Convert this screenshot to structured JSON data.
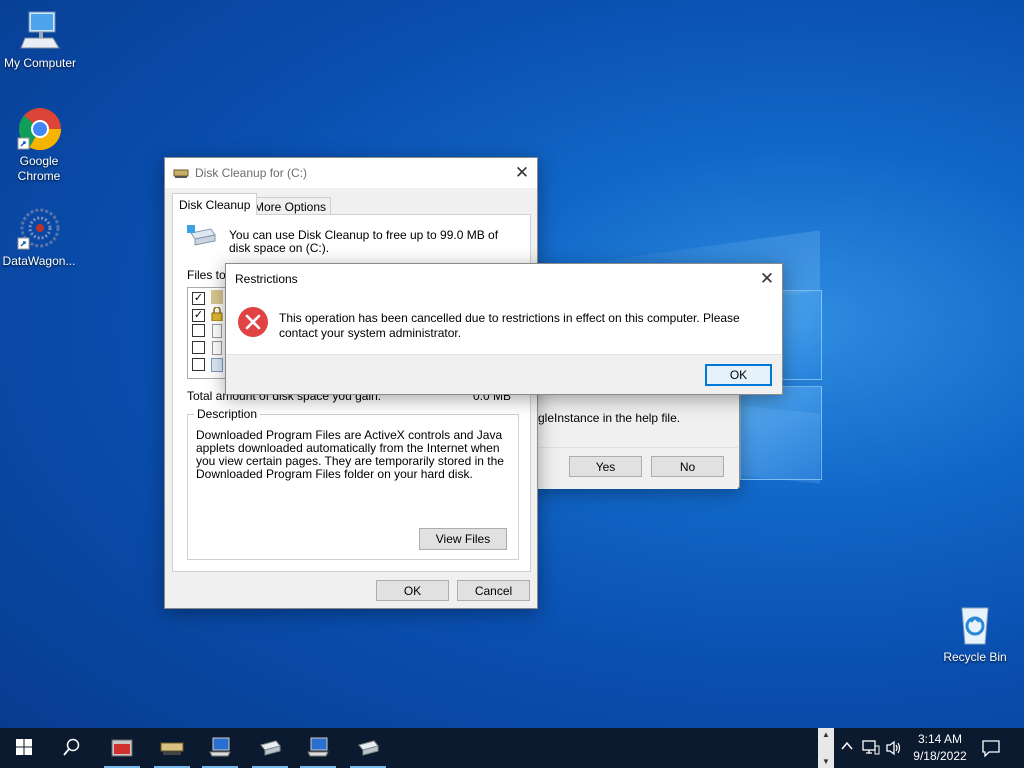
{
  "desktop": {
    "icons": [
      {
        "label": "My Computer"
      },
      {
        "label": "Google Chrome"
      },
      {
        "label": "DataWagon..."
      },
      {
        "label": "Recycle Bin"
      }
    ]
  },
  "disk_cleanup": {
    "title": "Disk Cleanup for  (C:)",
    "tabs": [
      {
        "label": "Disk Cleanup"
      },
      {
        "label": "More Options"
      }
    ],
    "intro": "You can use Disk Cleanup to free up to 99.0 MB of disk space on  (C:).",
    "files_label": "Files to d",
    "total_label": "Total amount of disk space you gain:",
    "total_value": "0.0 MB",
    "description_title": "Description",
    "description_text": "Downloaded Program Files are ActiveX controls and Java applets downloaded automatically from the Internet when you view certain pages. They are temporarily stored in the Downloaded Program Files folder on your hard disk.",
    "view_files": "View Files",
    "ok": "OK",
    "cancel": "Cancel"
  },
  "behind_dialog": {
    "text": "gleInstance in the help file.",
    "yes": "Yes",
    "no": "No"
  },
  "restrictions": {
    "title": "Restrictions",
    "message": "This operation has been cancelled due to restrictions in effect on this computer. Please contact your system administrator.",
    "ok": "OK"
  },
  "taskbar": {
    "time": "3:14 AM",
    "date": "9/18/2022"
  },
  "colors": {
    "accent": "#0078d7",
    "error": "#e81123",
    "taskbar": "#0b1a2e"
  }
}
